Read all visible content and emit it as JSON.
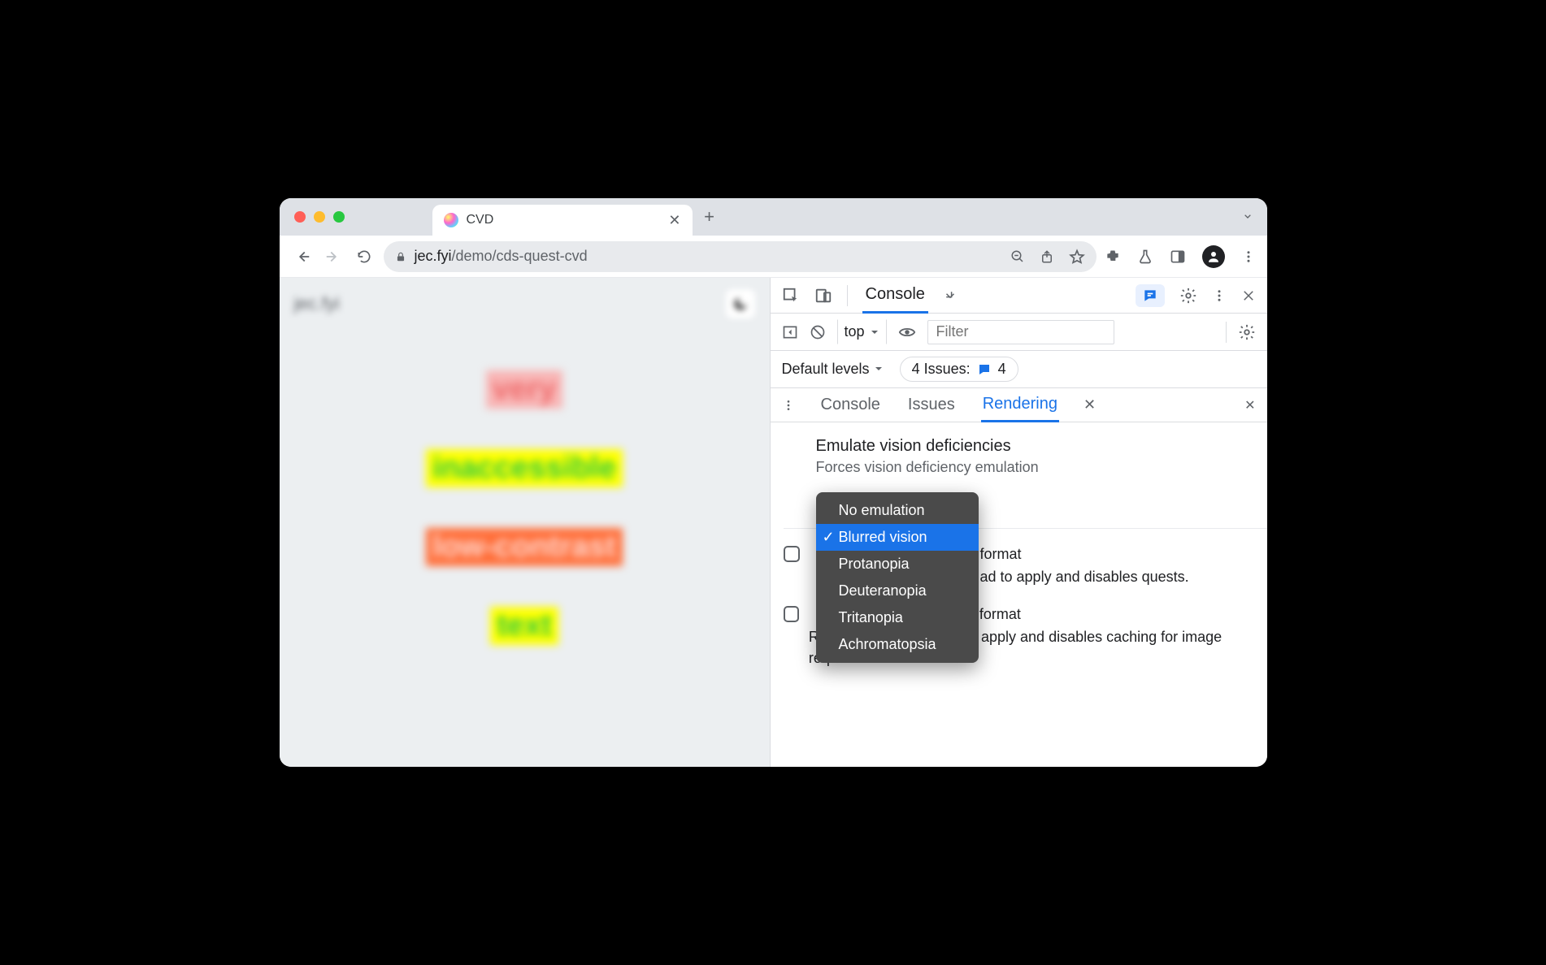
{
  "browser": {
    "tab_title": "CVD",
    "url_host": "jec.fyi",
    "url_path": "/demo/cds-quest-cvd"
  },
  "page": {
    "brand": "jec.fyi",
    "words": [
      "very",
      "inaccessible",
      "low-contrast",
      "text"
    ]
  },
  "devtools": {
    "main_tab": "Console",
    "console_bar": {
      "context": "top",
      "filter_placeholder": "Filter"
    },
    "levels": {
      "label": "Default levels",
      "issues_label": "4 Issues:",
      "issues_count": "4"
    },
    "drawer_tabs": {
      "console": "Console",
      "issues": "Issues",
      "rendering": "Rendering"
    },
    "rendering": {
      "title": "Emulate vision deficiencies",
      "subtitle": "Forces vision deficiency emulation",
      "row1_head": "format",
      "row1_body": "ad to apply and disables quests.",
      "row2_head": "format",
      "row2_body": "Requires a page reload to apply and disables caching for image requests."
    },
    "dropdown": {
      "items": [
        "No emulation",
        "Blurred vision",
        "Protanopia",
        "Deuteranopia",
        "Tritanopia",
        "Achromatopsia"
      ],
      "selected": "Blurred vision"
    }
  }
}
